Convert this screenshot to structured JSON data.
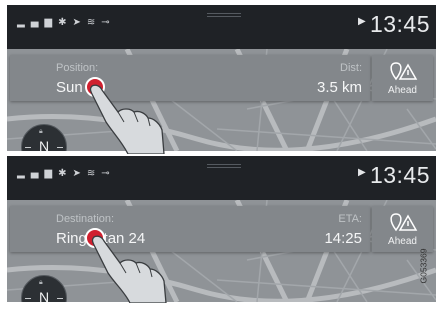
{
  "status": {
    "time": "13:45",
    "icons": [
      "signal-icon",
      "bluetooth-icon",
      "location-icon",
      "wifi-icon",
      "usb-icon",
      "play-icon"
    ]
  },
  "screen_top": {
    "label_left": "Position:",
    "value_left": "Sun",
    "label_right": "Dist:",
    "value_right": "3.5 km",
    "ahead_label": "Ahead",
    "compass": "N"
  },
  "screen_bottom": {
    "label_left": "Destination:",
    "value_left": "Ringgatan 24",
    "label_right": "ETA:",
    "value_right": "14:25",
    "ahead_label": "Ahead",
    "compass": "N"
  },
  "image_code": "G053369",
  "colors": {
    "touch_dot": "#d0202f",
    "map": "#8f9397",
    "card": "#83878b"
  }
}
